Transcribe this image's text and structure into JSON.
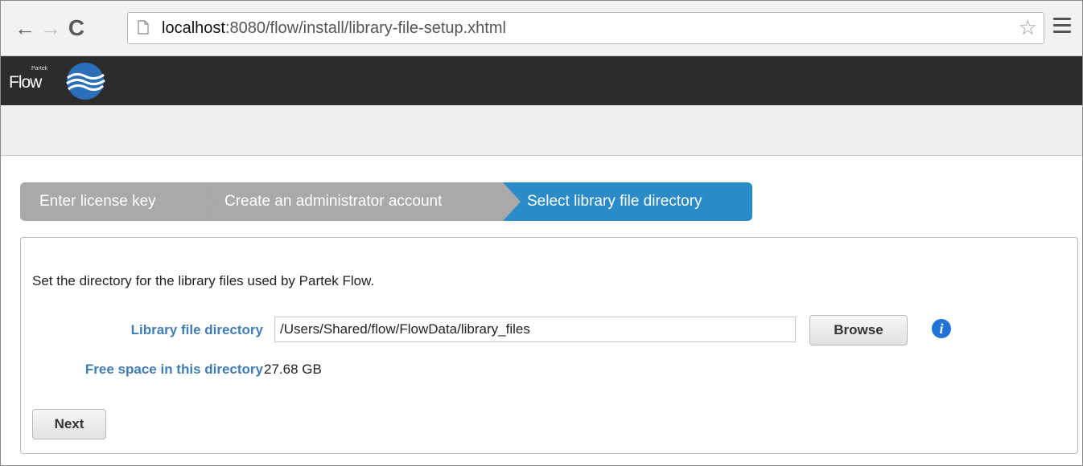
{
  "browser": {
    "url_host": "localhost",
    "url_rest": ":8080/flow/install/library-file-setup.xhtml",
    "back_icon": "←",
    "forward_icon": "→",
    "reload_icon": "C",
    "star_icon": "☆"
  },
  "app": {
    "logo_small": "Partek",
    "logo_text": "Flow"
  },
  "wizard": {
    "steps": [
      {
        "label": "Enter license key",
        "state": "done"
      },
      {
        "label": "Create an administrator account",
        "state": "done"
      },
      {
        "label": "Select library file directory",
        "state": "active"
      }
    ]
  },
  "form": {
    "description": "Set the directory for the library files used by Partek Flow.",
    "dir_label": "Library file directory",
    "dir_value": "/Users/Shared/flow/FlowData/library_files",
    "browse_label": "Browse",
    "info_icon": "i",
    "free_label": "Free space in this directory",
    "free_value": "27.68 GB",
    "next_label": "Next"
  },
  "colors": {
    "active_step": "#2a8bc8",
    "inactive_step": "#a9a9a9",
    "label_blue": "#3f7db4",
    "appbar": "#2c2c2c",
    "info_icon": "#1f73d6"
  }
}
